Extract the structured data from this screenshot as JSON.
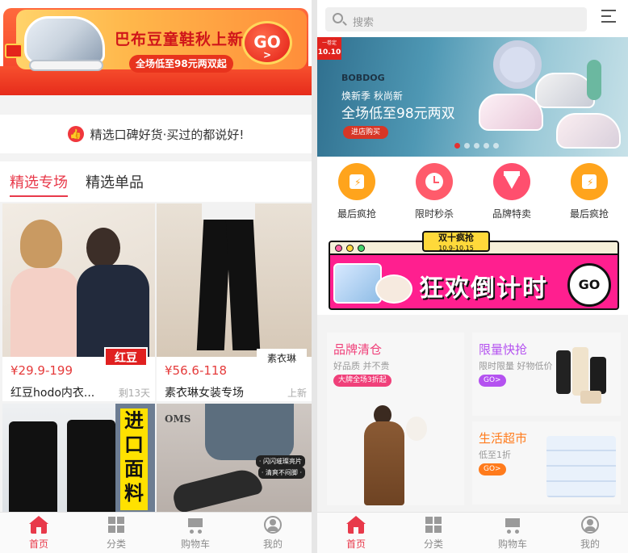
{
  "left": {
    "banner": {
      "title": "巴布豆童鞋秋上新",
      "subtitle": "全场低至98元两双起",
      "go": "GO",
      "go_arrow": ">"
    },
    "slogan": "精选口碑好货·买过的都说好!",
    "tabs": [
      "精选专场",
      "精选单品"
    ],
    "products": [
      {
        "price": "¥29.9-199",
        "name": "红豆hodo内衣...",
        "tag": "剩13天",
        "badge": "红豆"
      },
      {
        "price": "¥56.6-118",
        "name": "素衣琳女装专场",
        "tag": "上新",
        "badge": "素衣琳"
      },
      {
        "badge_lines": [
          "进",
          "口",
          "面",
          "料"
        ]
      },
      {
        "brand_mark": "OMS",
        "stickers": [
          "· 闪闪璀璨亮片",
          "· 清爽不闷脚 ·"
        ]
      }
    ]
  },
  "right": {
    "search": {
      "placeholder": "搜索"
    },
    "hero": {
      "flag": "10.10",
      "flag_top": "一卷定",
      "brand": "BOBDOG",
      "line1": "焕新季 秋尚新",
      "line2": "全场低至98元两双",
      "button": "进店购买"
    },
    "quick": [
      {
        "label": "最后疯抢",
        "color": "#ffa41c"
      },
      {
        "label": "限时秒杀",
        "color": "#ff5b6b"
      },
      {
        "label": "品牌特卖",
        "color": "#ff4f6e"
      },
      {
        "label": "最后疯抢",
        "color": "#ffa41c"
      }
    ],
    "promo": {
      "label_main": "双十疯抢",
      "label_date": "10.9-10.15",
      "big": "狂欢倒计时",
      "go": "GO"
    },
    "sections": [
      {
        "title": "品牌清仓",
        "desc": "好品质 并不贵",
        "pill": "大牌全场3折起",
        "color": "#f0407a"
      },
      {
        "title": "限量快抢",
        "desc": "限时限量 好物低价",
        "pill": "GO>",
        "color": "#b452f0"
      },
      {
        "title": "生活超市",
        "desc": "低至1折",
        "pill": "GO>",
        "color": "#ff7b1c"
      }
    ]
  },
  "tabbar": [
    {
      "label": "首页",
      "icon": "home-icon"
    },
    {
      "label": "分类",
      "icon": "grid-icon"
    },
    {
      "label": "购物车",
      "icon": "cart-icon"
    },
    {
      "label": "我的",
      "icon": "user-icon"
    }
  ],
  "colors": {
    "accent": "#e8394a",
    "inactive": "#8c8c8c"
  }
}
